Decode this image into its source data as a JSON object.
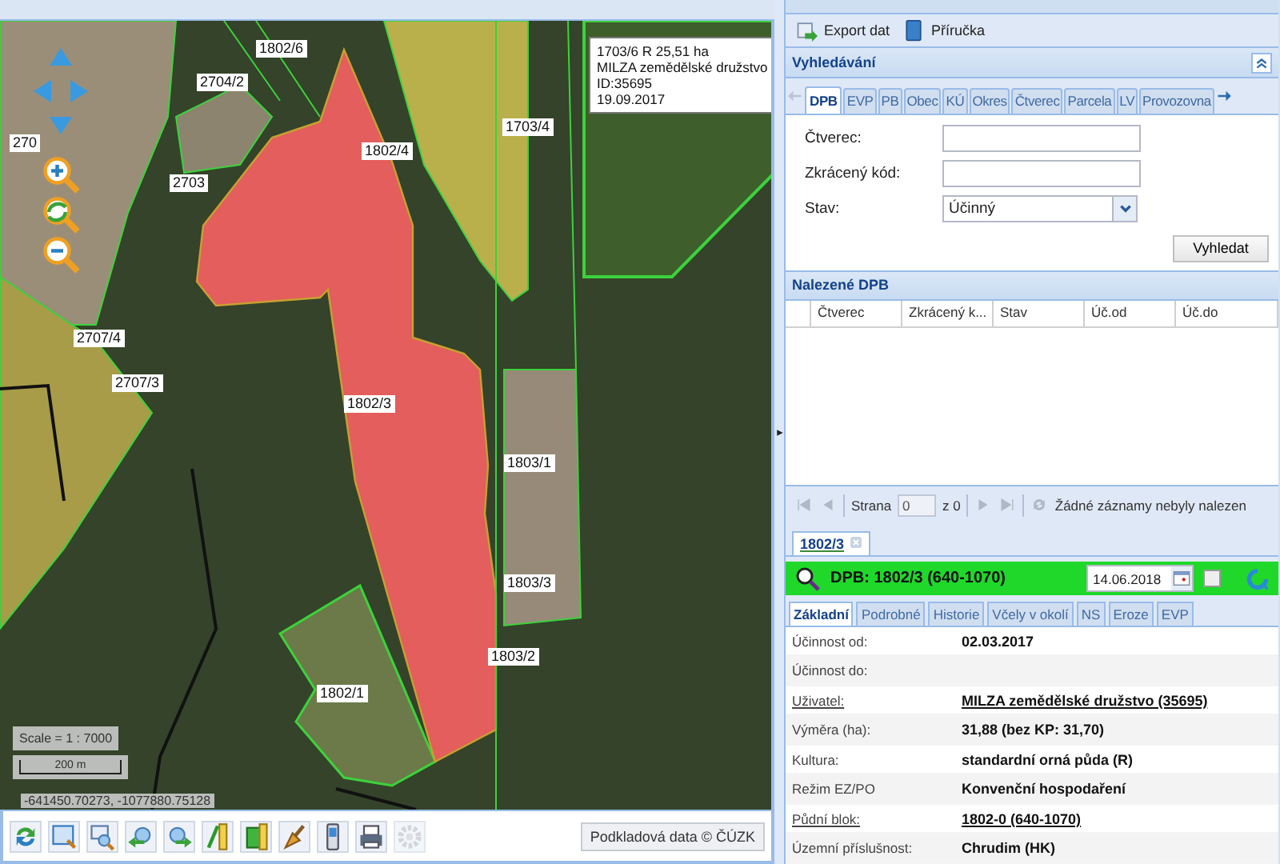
{
  "map": {
    "parcel_labels": [
      {
        "text": "1802/6"
      },
      {
        "text": "2704/2"
      },
      {
        "text": "270"
      },
      {
        "text": "2703"
      },
      {
        "text": "1802/4"
      },
      {
        "text": "1703/4"
      },
      {
        "text": "2707/4"
      },
      {
        "text": "2707/3"
      },
      {
        "text": "1802/3"
      },
      {
        "text": "1803/1"
      },
      {
        "text": "1803/3"
      },
      {
        "text": "1803/2"
      },
      {
        "text": "1802/1"
      }
    ],
    "info_box": [
      "1703/6 R 25,51 ha",
      "MILZA zemědělské družstvo",
      "ID:35695",
      "19.09.2017"
    ],
    "scale": "Scale = 1 : 7000",
    "scale_bar": "200 m",
    "coordinates": "-641450.70273, -1077880.75128"
  },
  "map_toolbar": {
    "base_data_button": "Podkladová data © ČÚZK"
  },
  "panel": {
    "toolbar": [
      "Export dat",
      "Příručka"
    ],
    "search": {
      "title": "Vyhledávání",
      "tabs": [
        {
          "label": "DPB",
          "selected": true
        },
        {
          "label": "EVP",
          "selected": false
        },
        {
          "label": "PB",
          "selected": false
        },
        {
          "label": "Obec",
          "selected": false
        },
        {
          "label": "KÚ",
          "selected": false
        },
        {
          "label": "Okres",
          "selected": false
        },
        {
          "label": "Čtverec",
          "selected": false
        },
        {
          "label": "Parcela",
          "selected": false
        },
        {
          "label": "LV",
          "selected": false
        },
        {
          "label": "Provozovna",
          "selected": false
        }
      ],
      "fields": [
        {
          "label": "Čtverec:",
          "kind": "text"
        },
        {
          "label": "Zkrácený kód:",
          "kind": "text"
        },
        {
          "label": "Stav:",
          "kind": "select",
          "value": "Účinný"
        }
      ],
      "button": "Vyhledat"
    },
    "results": {
      "title": "Nalezené DPB",
      "columns": [
        "Čtverec",
        "Zkrácený k...",
        "Stav",
        "Úč.od",
        "Úč.do"
      ],
      "pager": {
        "page_label": "Strana",
        "page": "0",
        "of": "z 0",
        "message": "Žádné záznamy nebyly nalezen"
      }
    },
    "detail": {
      "tab": "1802/3",
      "title": "DPB: 1802/3 (640-1070)",
      "date": "14.06.2018",
      "checked": false,
      "tabs": [
        {
          "label": "Základní",
          "selected": true
        },
        {
          "label": "Podrobné",
          "selected": false
        },
        {
          "label": "Historie",
          "selected": false
        },
        {
          "label": "Včely v okolí",
          "selected": false
        },
        {
          "label": "NS",
          "selected": false
        },
        {
          "label": "Eroze",
          "selected": false
        },
        {
          "label": "EVP",
          "selected": false
        }
      ],
      "rows": [
        {
          "label": "Účinnost od:",
          "value": "02.03.2017",
          "link": false
        },
        {
          "label": "Účinnost do:",
          "link": false
        },
        {
          "label": "Uživatel:",
          "value": "MILZA zemědělské družstvo (35695)",
          "link": true
        },
        {
          "label": "Výměra (ha):",
          "value": "31,88 (bez KP: 31,70)",
          "link": false
        },
        {
          "label": "Kultura:",
          "value": "standardní orná půda (R)",
          "link": false
        },
        {
          "label": "Režim EZ/PO",
          "value": "Konvenční hospodaření",
          "link": false
        },
        {
          "label": "Půdní blok:",
          "value": "1802-0 (640-1070)",
          "link": true
        },
        {
          "label": "Územní příslušnost:",
          "value": "Chrudim (HK)",
          "link": false
        }
      ]
    }
  }
}
